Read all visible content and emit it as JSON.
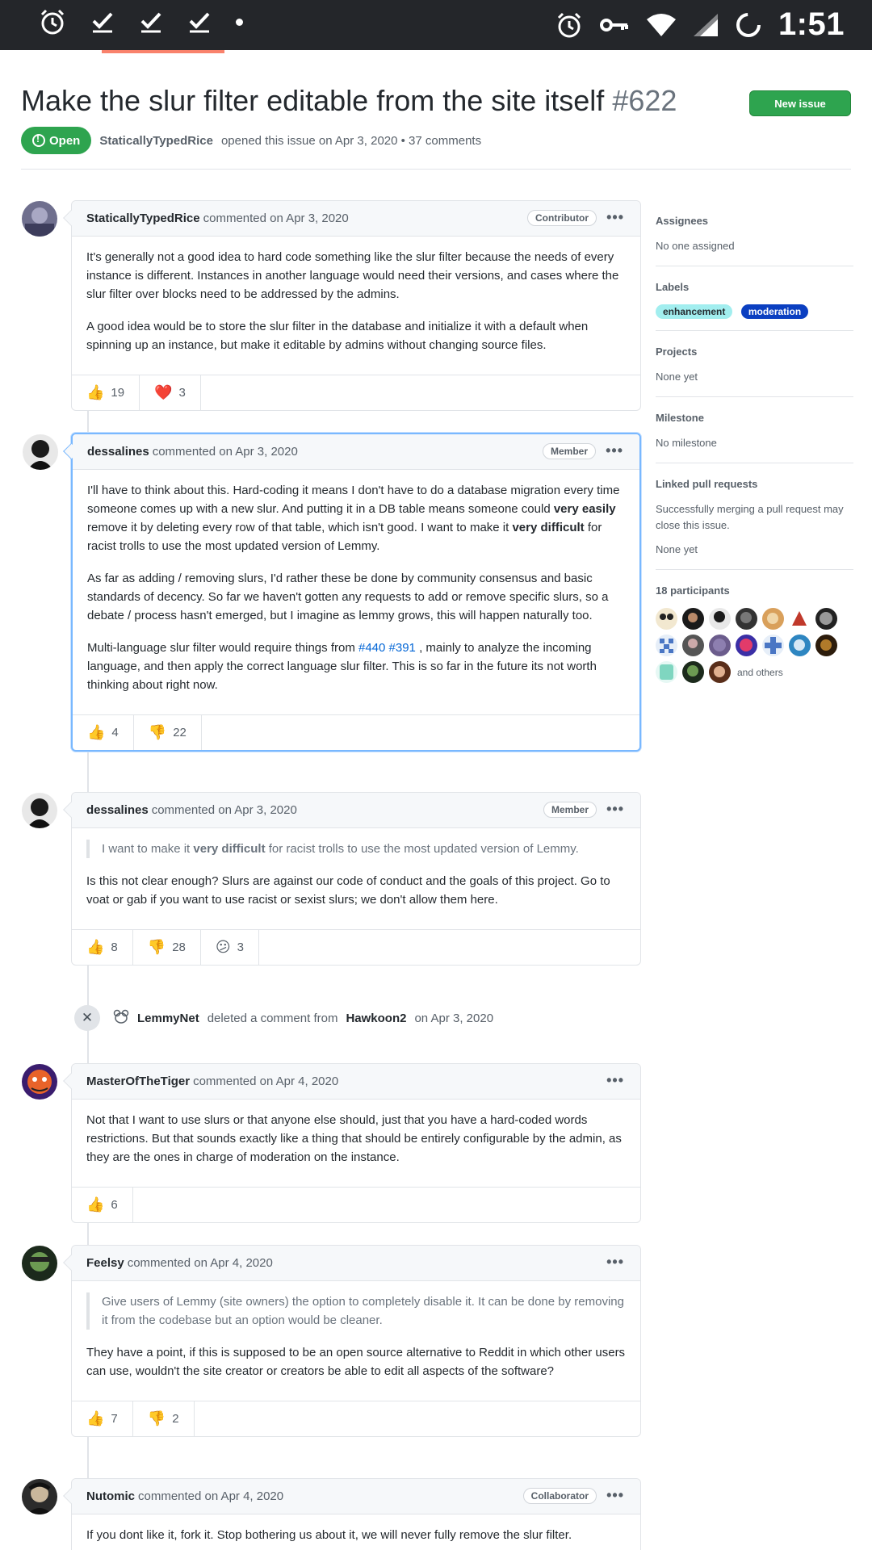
{
  "status_bar": {
    "time": "1:51",
    "left_icons": [
      "alarm-icon",
      "check-icon",
      "check-icon",
      "check-icon",
      "dot-icon"
    ],
    "right_icons": [
      "alarm-icon",
      "vpn-key-icon",
      "wifi-icon",
      "signal-icon",
      "battery-icon"
    ]
  },
  "issue": {
    "title": "Make the slur filter editable from the site itself",
    "number": "#622",
    "new_issue_label": "New issue",
    "state": "Open",
    "author": "StaticallyTypedRice",
    "meta_text": "opened this issue on Apr 3, 2020 • 37 comments"
  },
  "comments": [
    {
      "author": "StaticallyTypedRice",
      "action": "commented on Apr 3, 2020",
      "role": "Contributor",
      "paragraphs": [
        "It's generally not a good idea to hard code something like the slur filter because the needs of every instance is different. Instances in another language would need their versions, and cases where the slur filter over blocks need to be addressed by the admins.",
        "A good idea would be to store the slur filter in the database and initialize it with a default when spinning up an instance, but make it editable by admins without changing source files."
      ],
      "reactions": [
        {
          "emoji": "👍",
          "count": "19"
        },
        {
          "emoji": "❤️",
          "count": "3"
        }
      ]
    },
    {
      "author": "dessalines",
      "action": "commented on Apr 3, 2020",
      "role": "Member",
      "p1_a": "I'll have to think about this. Hard-coding it means I don't have to do a database migration every time someone comes up with a new slur. And putting it in a DB table means someone could ",
      "p1_b1": "very easily",
      "p1_c": " remove it by deleting every row of that table, which isn't good. I want to make it ",
      "p1_b2": "very difficult",
      "p1_d": " for racist trolls to use the most updated version of Lemmy.",
      "p2": "As far as adding / removing slurs, I'd rather these be done by community consensus and basic standards of decency. So far we haven't gotten any requests to add or remove specific slurs, so a debate / process hasn't emerged, but I imagine as lemmy grows, this will happen naturally too.",
      "p3_a": "Multi-language slur filter would require things from ",
      "p3_link1": "#440",
      "p3_link2": "#391",
      "p3_b": " , mainly to analyze the incoming language, and then apply the correct language slur filter. This is so far in the future its not worth thinking about right now.",
      "reactions": [
        {
          "emoji": "👍",
          "count": "4"
        },
        {
          "emoji": "👎",
          "count": "22"
        }
      ]
    },
    {
      "author": "dessalines",
      "action": "commented on Apr 3, 2020",
      "role": "Member",
      "quote_a": "I want to make it ",
      "quote_b": "very difficult",
      "quote_c": " for racist trolls to use the most updated version of Lemmy.",
      "text": "Is this not clear enough? Slurs are against our code of conduct and the goals of this project. Go to voat or gab if you want to use racist or sexist slurs; we don't allow them here.",
      "reactions": [
        {
          "emoji": "👍",
          "count": "8"
        },
        {
          "emoji": "👎",
          "count": "28"
        },
        {
          "emoji": "😕",
          "count": "3"
        }
      ]
    },
    {
      "author": "MasterOfTheTiger",
      "action": "commented on Apr 4, 2020",
      "text": "Not that I want to use slurs or that anyone else should, just that you have a hard-coded words restrictions. But that sounds exactly like a thing that should be entirely configurable by the admin, as they are the ones in charge of moderation on the instance.",
      "reactions": [
        {
          "emoji": "👍",
          "count": "6"
        }
      ]
    },
    {
      "author": "Feelsy",
      "action": "commented on Apr 4, 2020",
      "quote": "Give users of Lemmy (site owners) the option to completely disable it. It can be done by removing it from the codebase but an option would be cleaner.",
      "text": "They have a point, if this is supposed to be an open source alternative to Reddit in which other users can use, wouldn't the site creator or creators be able to edit all aspects of the software?",
      "reactions": [
        {
          "emoji": "👍",
          "count": "7"
        },
        {
          "emoji": "👎",
          "count": "2"
        }
      ]
    },
    {
      "author": "Nutomic",
      "action": "commented on Apr 4, 2020",
      "role": "Collaborator",
      "text": "If you dont like it, fork it. Stop bothering us about it, we will never fully remove the slur filter."
    }
  ],
  "event": {
    "actor": "LemmyNet",
    "text": "deleted a comment from",
    "target": "Hawkoon2",
    "date": "on Apr 3, 2020"
  },
  "sidebar": {
    "assignees_title": "Assignees",
    "assignees_value": "No one assigned",
    "labels_title": "Labels",
    "labels": [
      {
        "name": "enhancement",
        "bg": "#a2eeef",
        "fg": "#24292e"
      },
      {
        "name": "moderation",
        "bg": "#0b3fc1",
        "fg": "#ffffff"
      }
    ],
    "projects_title": "Projects",
    "projects_value": "None yet",
    "milestone_title": "Milestone",
    "milestone_value": "No milestone",
    "linked_title": "Linked pull requests",
    "linked_desc": "Successfully merging a pull request may close this issue.",
    "linked_value": "None yet",
    "participants_title": "18 participants",
    "and_others": "and others"
  },
  "colors": {
    "accent_green": "#2ea44f",
    "link_blue": "#0366d6",
    "highlight_border": "#79b8ff"
  }
}
